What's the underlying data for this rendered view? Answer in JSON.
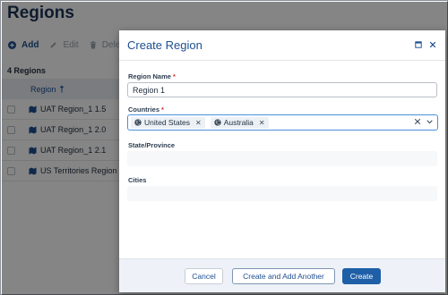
{
  "page": {
    "title": "Regions",
    "toolbar": {
      "add": "Add",
      "edit": "Edit",
      "delete": "Delete"
    },
    "count_label": "4 Regions",
    "grid": {
      "column_header": "Region",
      "rows": [
        "UAT Region_1 1.5",
        "UAT Region_1 2.0",
        "UAT Region_1 2.1",
        "US Territories Region"
      ]
    }
  },
  "dialog": {
    "title": "Create Region",
    "fields": {
      "region_name": {
        "label": "Region Name",
        "required": "*",
        "value": "Region 1"
      },
      "countries": {
        "label": "Countries",
        "required": "*",
        "selected": [
          "United States",
          "Australia"
        ]
      },
      "state_province": {
        "label": "State/Province"
      },
      "cities": {
        "label": "Cities"
      }
    },
    "buttons": {
      "cancel": "Cancel",
      "create_another": "Create and Add Another",
      "create": "Create"
    }
  },
  "colors": {
    "accent": "#1d4f91",
    "primary_button": "#1f5fa8",
    "required": "#d62c2c",
    "focus_border": "#4a90d9"
  },
  "icons": [
    "plus-circle-icon",
    "pencil-icon",
    "trash-icon",
    "sort-arrow-up-icon",
    "map-icon",
    "maximize-icon",
    "close-icon",
    "globe-icon",
    "clear-icon",
    "chevron-down-icon"
  ]
}
